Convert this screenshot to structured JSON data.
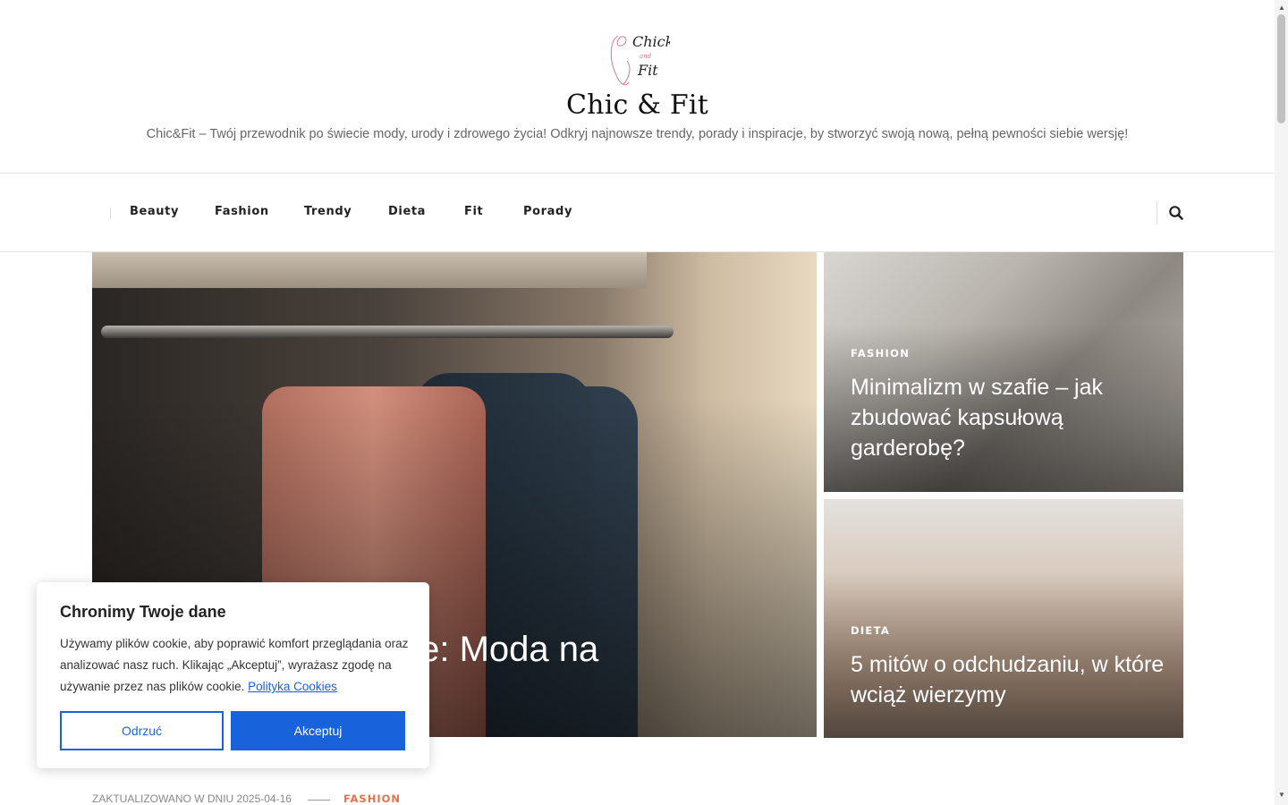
{
  "header": {
    "title": "Chic & Fit",
    "tagline": "Chic&Fit – Twój przewodnik po świecie mody, urody i zdrowego życia! Odkryj najnowsze trendy, porady i inspiracje, by stworzyć swoją nową, pełną pewności siebie wersję!",
    "logo_text_1": "Chick",
    "logo_text_2": "and",
    "logo_text_3": "Fit"
  },
  "nav": {
    "items": [
      "Beauty",
      "Fashion",
      "Trendy",
      "Dieta",
      "Fit",
      "Porady"
    ],
    "search_icon": "search-icon"
  },
  "featured": {
    "main": {
      "title_visible": "jne: Moda na"
    },
    "side": [
      {
        "category": "FASHION",
        "title": "Minimalizm w szafie – jak zbudować kapsułową garderobę?"
      },
      {
        "category": "DIETA",
        "title": "5 mitów o odchudzaniu, w które wciąż wierzymy"
      }
    ]
  },
  "cookie": {
    "title": "Chronimy Twoje dane",
    "text": "Używamy plików cookie, aby poprawić komfort przeglądania oraz analizować nasz ruch. Klikając „Akceptuj”, wyrażasz zgodę na używanie przez nas plików cookie.",
    "link": "Polityka Cookies",
    "reject": "Odrzuć",
    "accept": "Akceptuj",
    "accent_color": "#1863dc"
  },
  "meta": {
    "updated": "ZAKTUALIZOWANO W DNIU 2025-04-16",
    "category": "FASHION",
    "category_color": "#e0744f"
  }
}
